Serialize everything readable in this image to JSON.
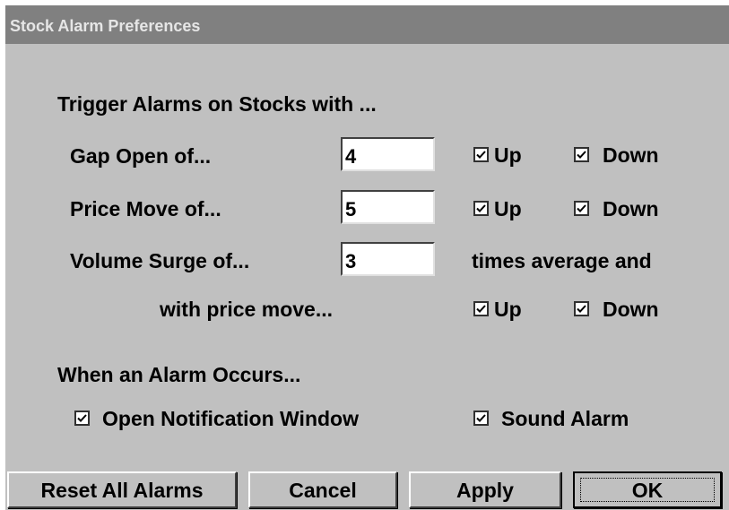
{
  "window": {
    "title": "Stock Alarm Preferences"
  },
  "trigger_section": {
    "heading": "Trigger Alarms on Stocks with ...",
    "gap_open": {
      "label": "Gap Open of...",
      "value": "4",
      "up_label": "Up",
      "up_checked": true,
      "down_label": "Down",
      "down_checked": true
    },
    "price_move": {
      "label": "Price Move of...",
      "value": "5",
      "up_label": "Up",
      "up_checked": true,
      "down_label": "Down",
      "down_checked": true
    },
    "volume_surge": {
      "label": "Volume Surge of...",
      "value": "3",
      "suffix": "times average and"
    },
    "with_price_move": {
      "label": "with price move...",
      "up_label": "Up",
      "up_checked": true,
      "down_label": "Down",
      "down_checked": true
    }
  },
  "occurs_section": {
    "heading": "When an Alarm Occurs...",
    "open_notification": {
      "label": "Open Notification Window",
      "checked": true
    },
    "sound_alarm": {
      "label": "Sound Alarm",
      "checked": true
    }
  },
  "buttons": {
    "reset_label": "Reset All Alarms",
    "cancel_label": "Cancel",
    "apply_label": "Apply",
    "ok_label": "OK"
  },
  "icons": {
    "checkbox_mark": "checkmark-icon"
  },
  "colors": {
    "dialog_bg": "#c0c0c0",
    "titlebar_bg": "#808080",
    "titlebar_text": "#e6e6e6",
    "field_bg": "#ffffff"
  }
}
